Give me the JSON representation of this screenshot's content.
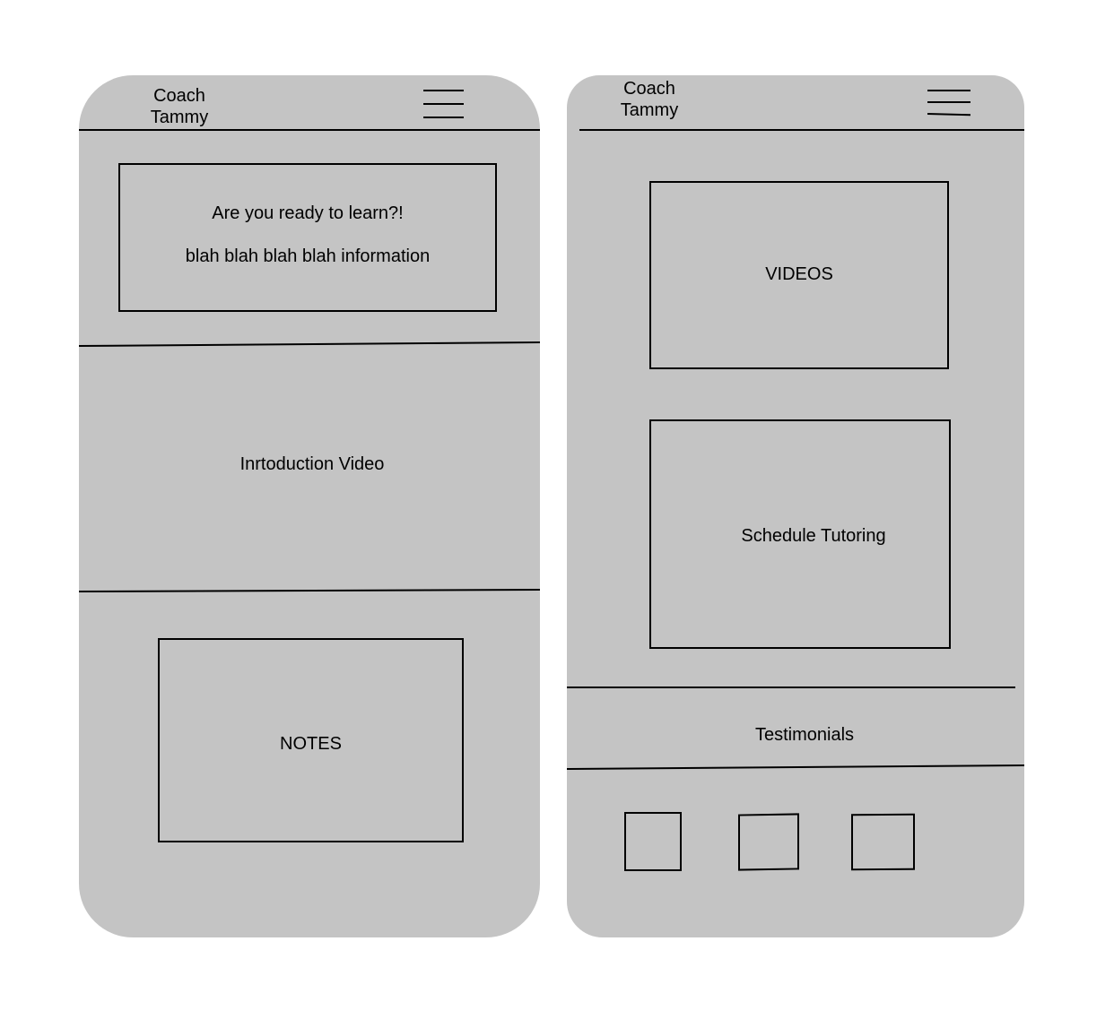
{
  "left_screen": {
    "brand": {
      "line1": "Coach",
      "line2": "Tammy"
    },
    "menu_icon": "hamburger-icon",
    "hero": {
      "heading": "Are you ready to learn?!",
      "body": "blah blah blah blah information"
    },
    "intro_video_label": "Inrtoduction Video",
    "notes_label": "NOTES"
  },
  "right_screen": {
    "brand": {
      "line1": "Coach",
      "line2": "Tammy"
    },
    "menu_icon": "hamburger-icon",
    "videos_label": "VIDEOS",
    "schedule_label": "Schedule Tutoring",
    "testimonials_label": "Testimonials",
    "testimonial_cards": [
      {
        "icon": "placeholder-square"
      },
      {
        "icon": "placeholder-square"
      },
      {
        "icon": "placeholder-square"
      }
    ]
  },
  "colors": {
    "screen_background": "#c4c4c4",
    "page_background": "#ffffff",
    "stroke": "#000000"
  }
}
